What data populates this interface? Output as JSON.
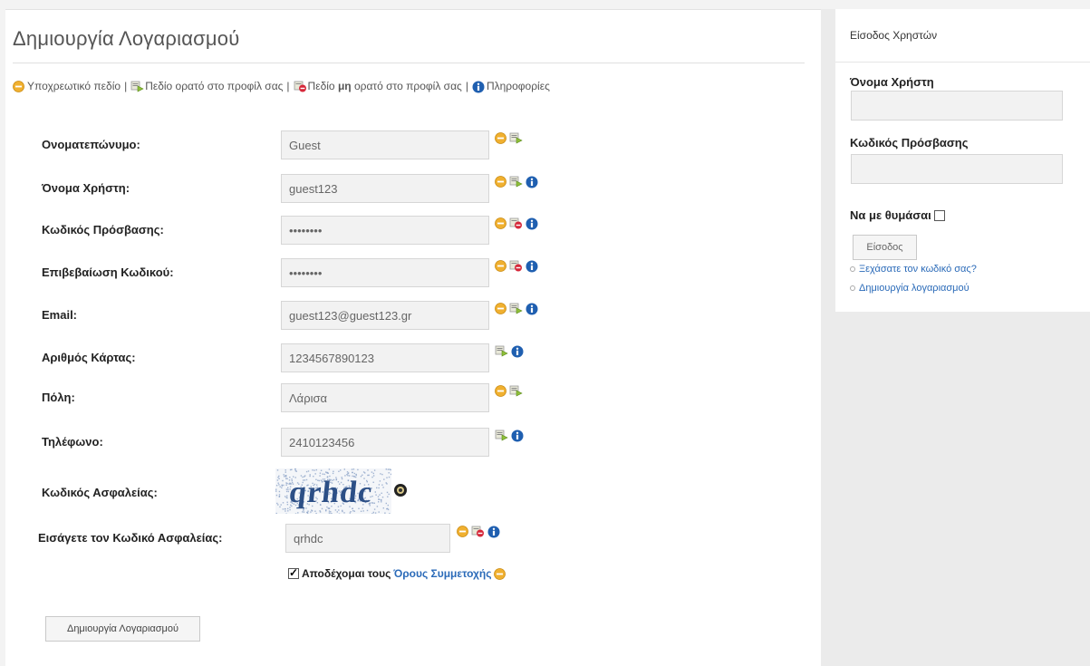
{
  "page": {
    "title": "Δημιουργία Λογαριασμού"
  },
  "legend": {
    "required": "Υποχρεωτικό πεδίο",
    "visible": "Πεδίο ορατό στο προφίλ σας",
    "hidden_prefix": "Πεδίο",
    "hidden_strong": "μη",
    "hidden_suffix": "ορατό στο προφίλ σας",
    "info": "Πληροφορίες",
    "separator": "|"
  },
  "form": {
    "fields": [
      {
        "label": "Ονοματεπώνυμο:",
        "value": "Guest",
        "icons": [
          "required",
          "visible"
        ]
      },
      {
        "label": "Όνομα Χρήστη:",
        "value": "guest123",
        "icons": [
          "required",
          "visible",
          "info"
        ]
      },
      {
        "label": "Κωδικός Πρόσβασης:",
        "value": "••••••••",
        "icons": [
          "required",
          "hidden",
          "info"
        ]
      },
      {
        "label": "Επιβεβαίωση Κωδικού:",
        "value": "••••••••",
        "icons": [
          "required",
          "hidden",
          "info"
        ]
      },
      {
        "label": "Email:",
        "value": "guest123@guest123.gr",
        "icons": [
          "required",
          "visible",
          "info"
        ]
      },
      {
        "label": "Αριθμός Κάρτας:",
        "value": "1234567890123",
        "icons": [
          "visible",
          "info"
        ]
      },
      {
        "label": "Πόλη:",
        "value": "Λάρισα",
        "icons": [
          "required",
          "visible"
        ]
      },
      {
        "label": "Τηλέφωνο:",
        "value": "2410123456",
        "icons": [
          "visible",
          "info"
        ]
      }
    ],
    "captcha_label": "Κωδικός Ασφαλείας:",
    "captcha_text": "qrhdc",
    "captcha_input_label": "Εισάγετε τον Κωδικό Ασφαλείας:",
    "captcha_input_value": "qrhdc",
    "terms_prefix": "Αποδέχομαι τους",
    "terms_link": "Όρους Συμμετοχής",
    "terms_checked": true,
    "submit_label": "Δημιουργία Λογαριασμού"
  },
  "login": {
    "title": "Είσοδος Χρηστών",
    "username_label": "Όνομα Χρήστη",
    "password_label": "Κωδικός Πρόσβασης",
    "remember_label": "Να με θυμάσαι",
    "submit_label": "Είσοδος",
    "links": [
      "Ξεχάσατε τον κωδικό σας?",
      "Δημιουργία λογαριασμού"
    ]
  },
  "colors": {
    "required": "#f0b030",
    "visible": "#8fbf3a",
    "hidden": "#d6283a",
    "info": "#1f5fb0",
    "link": "#2a6ab8"
  }
}
